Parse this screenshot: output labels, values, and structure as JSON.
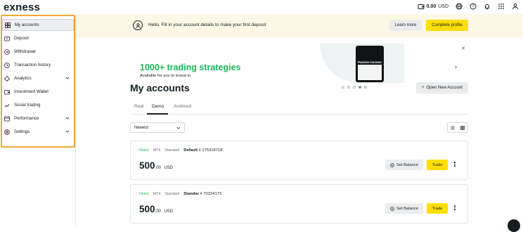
{
  "header": {
    "logo": "exness",
    "balance_value": "0.00",
    "balance_currency": "USD"
  },
  "sidebar": {
    "items": [
      {
        "label": "My accounts",
        "icon": "grid-icon",
        "active": true
      },
      {
        "label": "Deposit",
        "icon": "deposit-icon"
      },
      {
        "label": "Withdrawal",
        "icon": "withdrawal-icon"
      },
      {
        "label": "Transaction history",
        "icon": "history-icon"
      },
      {
        "label": "Analytics",
        "icon": "analytics-icon",
        "expandable": true
      },
      {
        "label": "Investment Wallet",
        "icon": "wallet-icon"
      },
      {
        "label": "Social trading",
        "icon": "social-icon"
      },
      {
        "label": "Performance",
        "icon": "performance-icon",
        "expandable": true
      },
      {
        "label": "Settings",
        "icon": "gear-icon",
        "expandable": true
      }
    ]
  },
  "notice": {
    "message": "Hello. Fill in your account details to make your first deposit",
    "learn_more": "Learn more",
    "complete_profile": "Complete profile"
  },
  "banner": {
    "title": "1000+ trading strategies",
    "subtitle": "Available for you to invest in",
    "phone_text": "Passive income",
    "slides": 5,
    "active_slide": 4
  },
  "page": {
    "title": "My accounts",
    "open_account": "Open New Account",
    "tabs": [
      "Real",
      "Demo",
      "Archived"
    ],
    "active_tab": "Demo",
    "sort_value": "Newest"
  },
  "accounts": [
    {
      "type": "Demo",
      "platform": "MT5",
      "kind": "Standard",
      "name": "Default",
      "number": "# 175318718",
      "balance_int": "500",
      "balance_dec": ".00",
      "currency": "USD",
      "set_balance": "Set Balance",
      "trade": "Trade"
    },
    {
      "type": "Demo",
      "platform": "MT4",
      "kind": "Standard",
      "name": "Standar",
      "number": "# 70324173",
      "balance_int": "500",
      "balance_dec": ".00",
      "currency": "USD",
      "set_balance": "Set Balance",
      "trade": "Trade"
    }
  ],
  "colors": {
    "accent_yellow": "#ffde02",
    "brand_green": "#1eb45a",
    "highlight_orange": "#f0a830",
    "notice_bg": "#fdf8e6"
  }
}
